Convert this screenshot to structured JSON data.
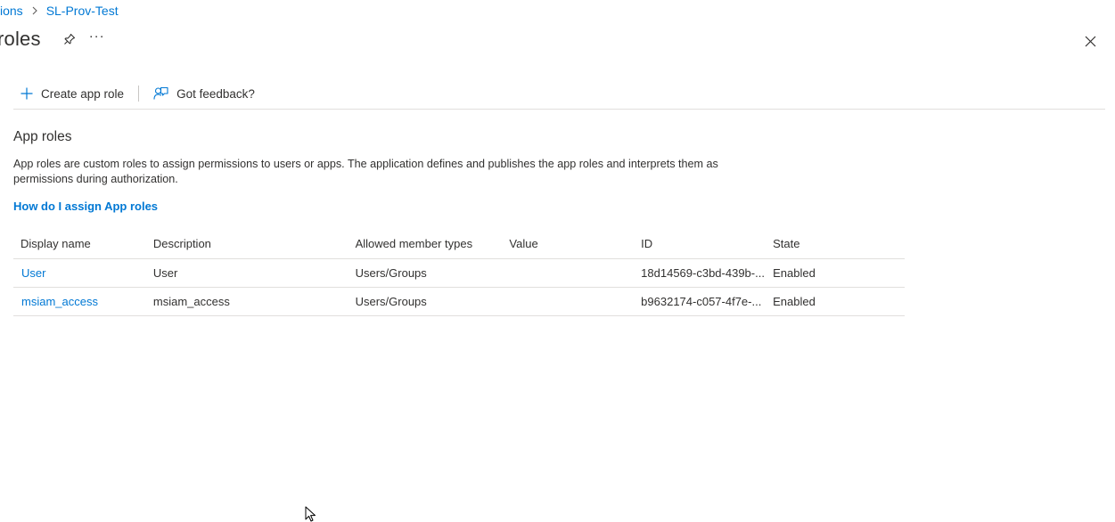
{
  "breadcrumb": {
    "items": [
      "ions",
      "SL-Prov-Test"
    ]
  },
  "header": {
    "title": "roles",
    "more_label": "···"
  },
  "toolbar": {
    "create_label": "Create app role",
    "feedback_label": "Got feedback?"
  },
  "section": {
    "title": "App roles",
    "description": "App roles are custom roles to assign permissions to users or apps. The application defines and publishes the app roles and interprets them as permissions during authorization.",
    "help_link": "How do I assign App roles"
  },
  "table": {
    "columns": [
      "Display name",
      "Description",
      "Allowed member types",
      "Value",
      "ID",
      "State"
    ],
    "rows": [
      {
        "display_name": "User",
        "description": "User",
        "member_types": "Users/Groups",
        "value": "",
        "id": "18d14569-c3bd-439b-...",
        "state": "Enabled"
      },
      {
        "display_name": "msiam_access",
        "description": "msiam_access",
        "member_types": "Users/Groups",
        "value": "",
        "id": "b9632174-c057-4f7e-...",
        "state": "Enabled"
      }
    ]
  },
  "colors": {
    "link": "#0078d4",
    "text": "#323130",
    "divider": "#e1dfdd"
  }
}
